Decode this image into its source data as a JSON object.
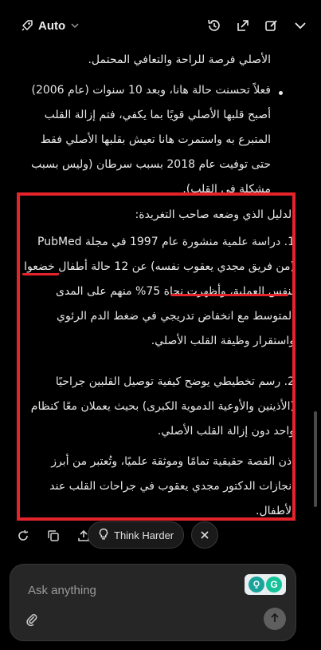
{
  "header": {
    "model_label": "Auto",
    "icons": [
      "rocket-icon",
      "chevron-down-icon",
      "history-icon",
      "external-link-icon",
      "edit-icon",
      "chevron-down-icon"
    ]
  },
  "message": {
    "top_fragment": "الأصلي فرصة للراحة والتعافي المحتمل.",
    "bullet": "فعلاً تحسنت حالة هانا، وبعد 10 سنوات (عام 2006) أصبح قلبها الأصلي قويًا بما يكفي، فتم إزالة القلب المتبرع به واستمرت هانا تعيش بقلبها الأصلي فقط حتى توفيت عام 2018 بسبب سرطان (وليس بسبب مشكلة في القلب).",
    "evidence_title": "الدليل الذي وضعه صاحب التغريدة:",
    "items": [
      "1. دراسة علمية منشورة عام 1997 في مجلة PubMed (من فريق مجدي يعقوب نفسه) عن 12 حالة أطفال خضعوا لنفس العملية، وأظهرت نجاة 75% منهم على المدى المتوسط مع انخفاض تدريجي في ضغط الدم الرئوي واستقرار وظيفة القلب الأصلي.",
      "2. رسم تخطيطي يوضح كيفية توصيل القلبين جراحيًا (الأذينين والأوعية الدموية الكبرى) بحيث يعملان معًا كنظام واحد دون إزالة القلب الأصلي."
    ],
    "conclusion": "إذن القصة حقيقية تمامًا وموثقة علميًا، وتُعتبر من أبرز إنجازات الدكتور مجدي يعقوب في جراحات القلب عند الأطفال."
  },
  "actions": {
    "think_harder_label": "Think Harder"
  },
  "composer": {
    "placeholder": "Ask anything",
    "extension_badge_letter": "G"
  },
  "colors": {
    "background": "#000000",
    "annotation_red": "#e5232b",
    "composer_bg": "#262626"
  }
}
